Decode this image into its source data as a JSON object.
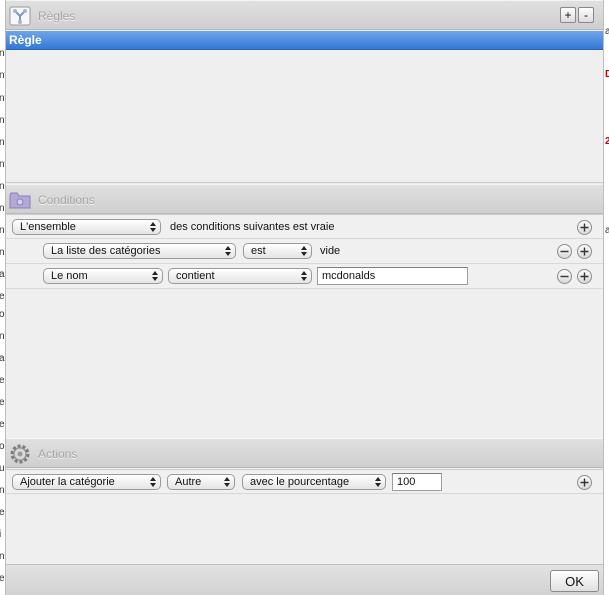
{
  "window": {
    "title": "Règles",
    "add_label": "+",
    "remove_label": "-"
  },
  "rules_table": {
    "column_header": "Règle"
  },
  "conditions": {
    "title": "Conditions",
    "match_popup": "L'ensemble",
    "match_text": "des conditions suivantes est vraie",
    "rows": [
      {
        "field": "La liste des catégories",
        "operator": "est",
        "value_text": "vide"
      },
      {
        "field": "Le nom",
        "operator": "contient",
        "value": "mcdonalds"
      }
    ]
  },
  "actions": {
    "title": "Actions",
    "action_popup": "Ajouter la catégorie",
    "category_popup": "Autre",
    "mode_popup": "avec le pourcentage",
    "percentage": "100"
  },
  "ok_label": "OK",
  "background": {
    "left_fragments": [
      "n",
      "nt",
      "nt",
      "nt",
      "n",
      "nt",
      "n",
      "n",
      "n",
      "n",
      "a",
      "e",
      "o",
      "n",
      "a",
      "e",
      "e",
      "e",
      "o",
      "u",
      "n",
      "e",
      "i",
      "n",
      "e",
      "a",
      "e",
      "n"
    ],
    "right_fragments": [
      "a",
      "D",
      "2",
      "a"
    ]
  }
}
